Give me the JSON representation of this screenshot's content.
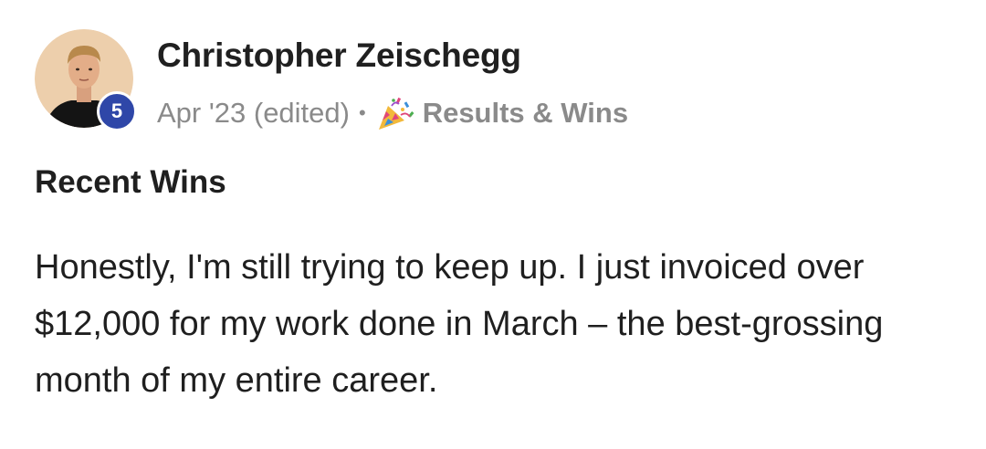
{
  "author": {
    "name": "Christopher Zeischegg",
    "level": "5"
  },
  "meta": {
    "date": "Apr '23 (edited)",
    "separator": "•",
    "category_icon": "party-popper-icon",
    "category": "Results & Wins"
  },
  "post": {
    "title": "Recent Wins",
    "body": "Honestly, I'm still trying to keep up. I just invoiced over $12,000 for my work done in March – the best-grossing month of my entire career."
  },
  "colors": {
    "level_badge": "#2f47a8",
    "meta_text": "#8a8a8a",
    "text": "#1f1f1f"
  }
}
